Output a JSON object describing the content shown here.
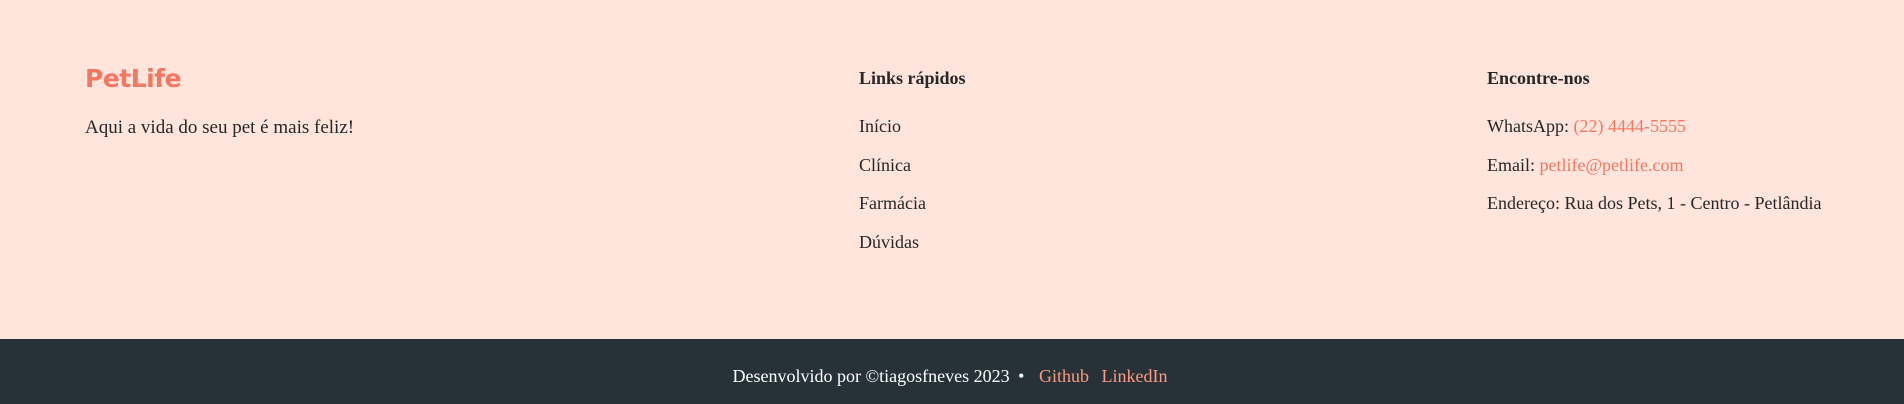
{
  "brand": {
    "logo": "PetLife",
    "tagline": "Aqui a vida do seu pet é mais feliz!"
  },
  "quick_links": {
    "title": "Links rápidos",
    "items": [
      {
        "label": "Início"
      },
      {
        "label": "Clínica"
      },
      {
        "label": "Farmácia"
      },
      {
        "label": "Dúvidas"
      }
    ]
  },
  "contact": {
    "title": "Encontre-nos",
    "whatsapp_label": "WhatsApp:",
    "whatsapp_value": "(22) 4444-5555",
    "email_label": "Email:",
    "email_value": "petlife@petlife.com",
    "address_label": "Endereço:",
    "address_value": "Rua dos Pets, 1 - Centro - Petlândia"
  },
  "bottom_bar": {
    "credit": "Desenvolvido por ©tiagosfneves 2023",
    "separator": "•",
    "links": [
      {
        "label": "Github"
      },
      {
        "label": "LinkedIn"
      }
    ]
  },
  "colors": {
    "background": "#FFE5DC",
    "accent": "#F47761",
    "bottom_bar": "#263238",
    "bottom_link": "#FF9A80"
  }
}
